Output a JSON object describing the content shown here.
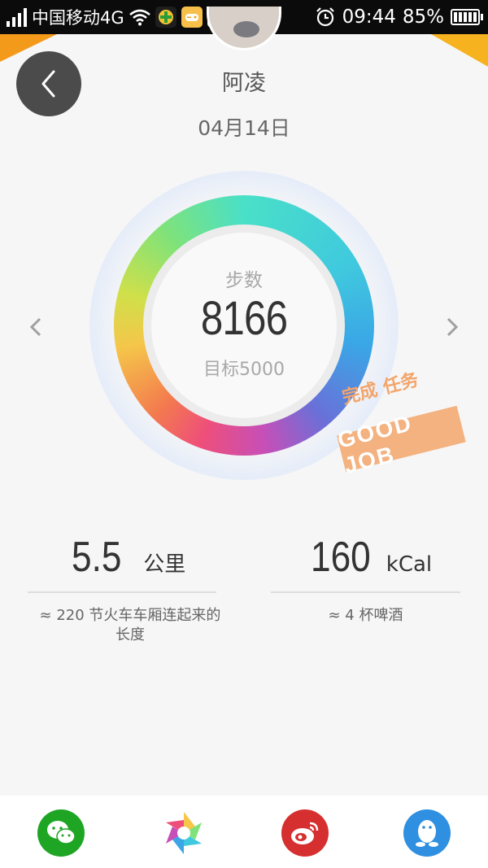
{
  "status_bar": {
    "carrier": "中国移动4G",
    "time": "09:44",
    "battery_percent": "85%"
  },
  "header": {
    "user_name": "阿凌",
    "date": "04月14日"
  },
  "steps": {
    "label": "步数",
    "value": "8166",
    "goal": "目标5000",
    "progress_fraction": 1.0
  },
  "stamp": {
    "top_text": "完成 任务",
    "main_text": "GOOD JOB"
  },
  "metrics": [
    {
      "value": "5.5",
      "unit": "公里",
      "description": "≈ 220  节火车车厢连起来的长度"
    },
    {
      "value": "160",
      "unit": "kCal",
      "description": "≈ 4 杯啤酒"
    }
  ],
  "share": {
    "icons": [
      "wechat-icon",
      "moments-icon",
      "weibo-icon",
      "qq-icon"
    ]
  },
  "colors": {
    "back_button": "#4b4b4b",
    "wechat": "#1fa524",
    "weibo": "#d62f2f",
    "qq": "#2f8fe0",
    "stamp": "#f3a46a"
  }
}
